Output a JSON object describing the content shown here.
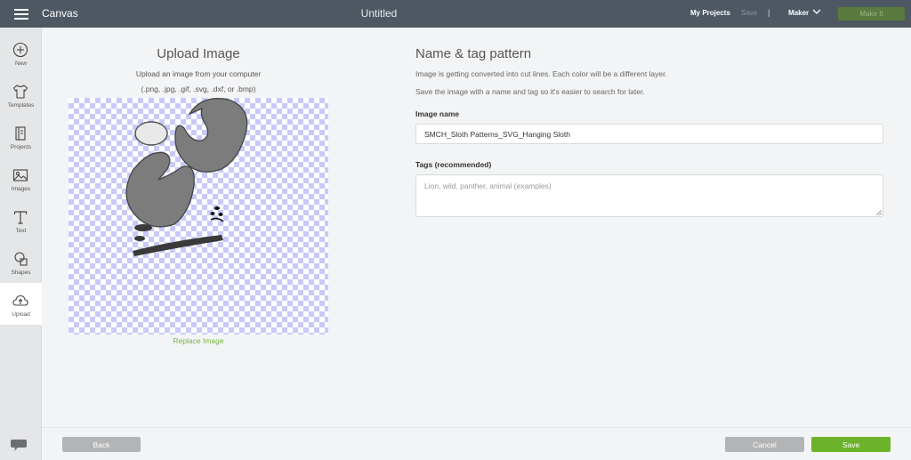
{
  "topbar": {
    "app_name": "Canvas",
    "doc_title": "Untitled",
    "my_projects": "My Projects",
    "save": "Save",
    "separator": "|",
    "maker": "Maker",
    "make_it": "Make It"
  },
  "sidebar": {
    "items": [
      {
        "label": "New",
        "icon": "plus-circle-icon"
      },
      {
        "label": "Templates",
        "icon": "tshirt-icon"
      },
      {
        "label": "Projects",
        "icon": "book-icon"
      },
      {
        "label": "Images",
        "icon": "image-icon"
      },
      {
        "label": "Text",
        "icon": "text-t-icon"
      },
      {
        "label": "Shapes",
        "icon": "shapes-icon"
      },
      {
        "label": "Upload",
        "icon": "cloud-upload-icon"
      }
    ],
    "active": "Upload"
  },
  "upload": {
    "title": "Upload Image",
    "subtitle": "Upload an image from your computer",
    "types": "(.png, .jpg, .gif, .svg, .dxf, or .bmp)",
    "replace": "Replace Image"
  },
  "form": {
    "title": "Name & tag pattern",
    "desc1": "Image is getting converted into cut lines. Each color will be a different layer.",
    "desc2": "Save the image with a name and tag so it's easier to search for later.",
    "name_label": "Image name",
    "name_value": "SMCH_Sloth Patterns_SVG_Hanging Sloth",
    "tags_label": "Tags (recommended)",
    "tags_placeholder": "Lion, wild, panther, animal (examples)"
  },
  "footer": {
    "back": "Back",
    "cancel": "Cancel",
    "save": "Save"
  },
  "colors": {
    "topbar": "#4d5862",
    "accent_green": "#6db22b",
    "link_green": "#75b53e",
    "checker": "#c9c9f9"
  }
}
